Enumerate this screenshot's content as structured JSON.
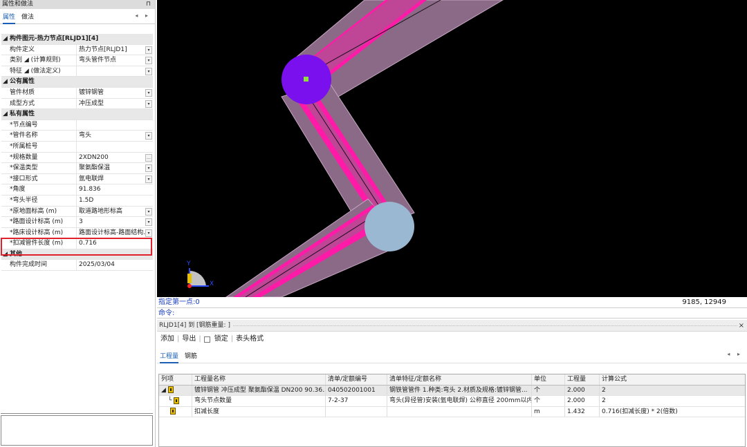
{
  "left_panel": {
    "title": "属性和做法",
    "pin": "⊓",
    "tabs": [
      "属性",
      "做法"
    ],
    "arrows": "◂ ▸",
    "rows": [
      {
        "type": "group",
        "label": "◢ 构件图元-热力节点[RLJD1][4]"
      },
      {
        "type": "row",
        "key": "构件定义",
        "value": "热力节点[RLJD1]",
        "dropdown": true
      },
      {
        "type": "row",
        "key": "类别 ◢ (计算规则)",
        "value": "弯头管件节点",
        "dropdown": true
      },
      {
        "type": "row",
        "key": "特征 ◢ (做法定义)",
        "value": "",
        "dropdown": true
      },
      {
        "type": "group",
        "label": "◢ 公有属性"
      },
      {
        "type": "row",
        "key": "管件材质",
        "value": "镀锌钢管",
        "dropdown": true
      },
      {
        "type": "row",
        "key": "成型方式",
        "value": "冲压成型",
        "dropdown": true
      },
      {
        "type": "group",
        "label": "◢ 私有属性"
      },
      {
        "type": "row",
        "key": "*节点编号",
        "value": "",
        "dropdown": false
      },
      {
        "type": "row",
        "key": "*管件名称",
        "value": "弯头",
        "dropdown": true
      },
      {
        "type": "row",
        "key": "*所属桩号",
        "value": "",
        "dropdown": false
      },
      {
        "type": "row",
        "key": "*规格数量",
        "value": "2XDN200",
        "dropdown": true,
        "ellipsis": true
      },
      {
        "type": "row",
        "key": "*保温类型",
        "value": "聚氨酯保温",
        "dropdown": true
      },
      {
        "type": "row",
        "key": "*接口形式",
        "value": "氩电联焊",
        "dropdown": true
      },
      {
        "type": "row",
        "key": "*角度",
        "value": "91.836",
        "dropdown": false
      },
      {
        "type": "row",
        "key": "*弯头半径",
        "value": "1.5D",
        "dropdown": false
      },
      {
        "type": "row",
        "key": "*原地面标高 (m)",
        "value": "取道路地形标高",
        "dropdown": true
      },
      {
        "type": "row",
        "key": "*路面设计标高 (m)",
        "value": "3",
        "dropdown": true
      },
      {
        "type": "row",
        "key": "*路床设计标高 (m)",
        "value": "路面设计标高-路面结构...",
        "dropdown": true
      },
      {
        "type": "row",
        "key": "*扣减管件长度 (m)",
        "value": "0.716",
        "dropdown": false
      },
      {
        "type": "group",
        "label": "◢ 其他"
      },
      {
        "type": "row",
        "key": "构件完成时间",
        "value": "2025/03/04",
        "dropdown": false
      }
    ]
  },
  "canvas": {
    "axis_y": "Y",
    "axis_x": "X"
  },
  "command": {
    "prompt": "指定第一点:0",
    "coords": "9185, 12949",
    "input_label": "命令:"
  },
  "bottom_panel": {
    "title": "RLJD1[4] 到 [钢筋重量: ]",
    "close": "×",
    "toolbar": {
      "add": "添加",
      "sep1": "|",
      "export": "导出",
      "sep2": "|",
      "lock": "锁定",
      "sep3": "|",
      "header_format": "表头格式"
    },
    "tabs": [
      "工程量",
      "钢筋"
    ],
    "arrows": "◂ ▸",
    "table": {
      "headers": [
        "列项",
        "工程量名称",
        "清单/定额编号",
        "清单特征/定额名称",
        "单位",
        "工程量",
        "计算公式"
      ],
      "rows": [
        {
          "prefix": "◢",
          "name": "镀锌钢管 冲压成型 聚氨酯保温 DN200 90.36...",
          "code": "040502001001",
          "feature": "钢铁管管件 1.种类:弯头 2.材质及规格:镀锌钢管...",
          "unit": "个",
          "qty": "2.000",
          "formula": "2"
        },
        {
          "prefix": "└",
          "name": "弯头节点数量",
          "code": "7-2-37",
          "feature": "弯头(异径管)安装(氩电联焊) 公称直径 200mm以内",
          "unit": "个",
          "qty": "2.000",
          "formula": "2"
        },
        {
          "prefix": "",
          "name": "扣减长度",
          "code": "",
          "feature": "",
          "unit": "m",
          "qty": "1.432",
          "formula": "0.716(扣减长度) * 2(倍数)"
        }
      ]
    }
  },
  "colors": {
    "canvas_bg": "#000000",
    "pipe_fill": "#8a6a86",
    "pipe_magenta": "#ff1aa8",
    "node_purple": "#7a10ee",
    "node_blue": "#9ab8d2",
    "highlight": "#e0202a",
    "accent": "#1a5fb4"
  }
}
